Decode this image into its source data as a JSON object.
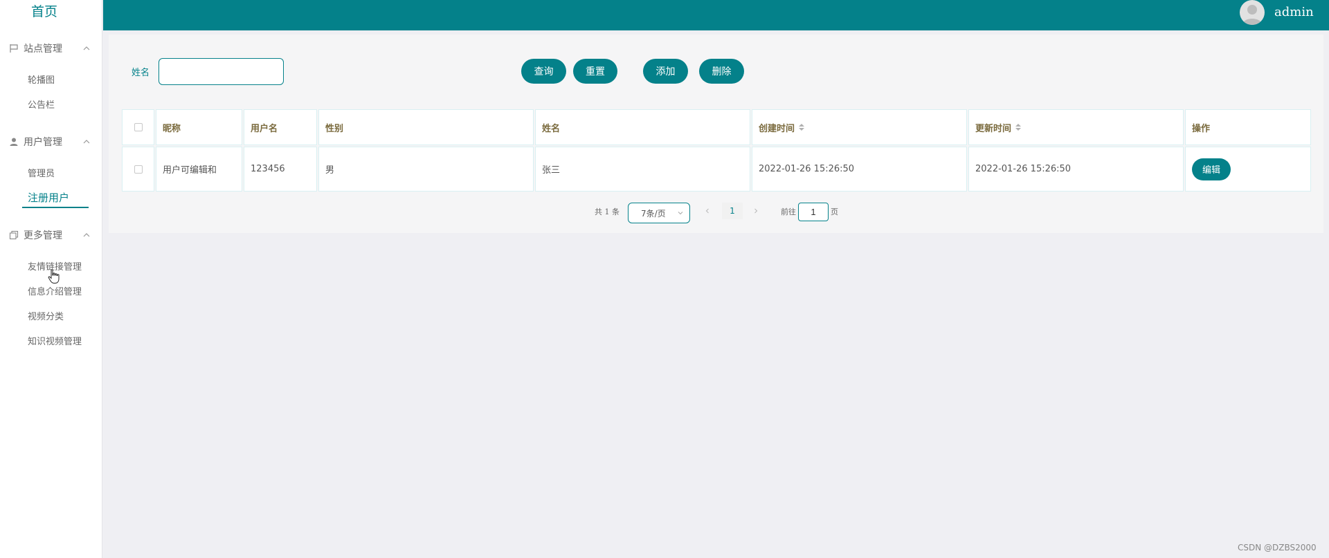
{
  "sidebar": {
    "home": "首页",
    "groups": [
      {
        "label": "站点管理",
        "icon": "flag-icon",
        "items": [
          "轮播图",
          "公告栏"
        ]
      },
      {
        "label": "用户管理",
        "icon": "user-icon",
        "items": [
          "管理员",
          "注册用户"
        ]
      },
      {
        "label": "更多管理",
        "icon": "copy-icon",
        "items": [
          "友情链接管理",
          "信息介绍管理",
          "视频分类",
          "知识视频管理"
        ]
      }
    ],
    "active_item": "注册用户"
  },
  "header": {
    "user_name": "admin"
  },
  "search": {
    "label": "姓名",
    "value": "",
    "placeholder": ""
  },
  "buttons": {
    "query": "查询",
    "reset": "重置",
    "add": "添加",
    "delete": "删除"
  },
  "table": {
    "columns": [
      "昵称",
      "用户名",
      "性别",
      "姓名",
      "创建时间",
      "更新时间",
      "操作"
    ],
    "rows": [
      {
        "nickname": "用户可编辑和",
        "username": "123456",
        "gender": "男",
        "name": "张三",
        "created": "2022-01-26 15:26:50",
        "updated": "2022-01-26 15:26:50",
        "action": "编辑"
      }
    ]
  },
  "pagination": {
    "total": "共 1 条",
    "page_size": "7条/页",
    "current_page": "1",
    "goto_label": "前往",
    "goto_value": "1",
    "page_unit": "页"
  },
  "watermark": "CSDN @DZBS2000",
  "colors": {
    "accent": "#04818a",
    "background": "#efeff3",
    "header_text": "#7a6a3d"
  }
}
